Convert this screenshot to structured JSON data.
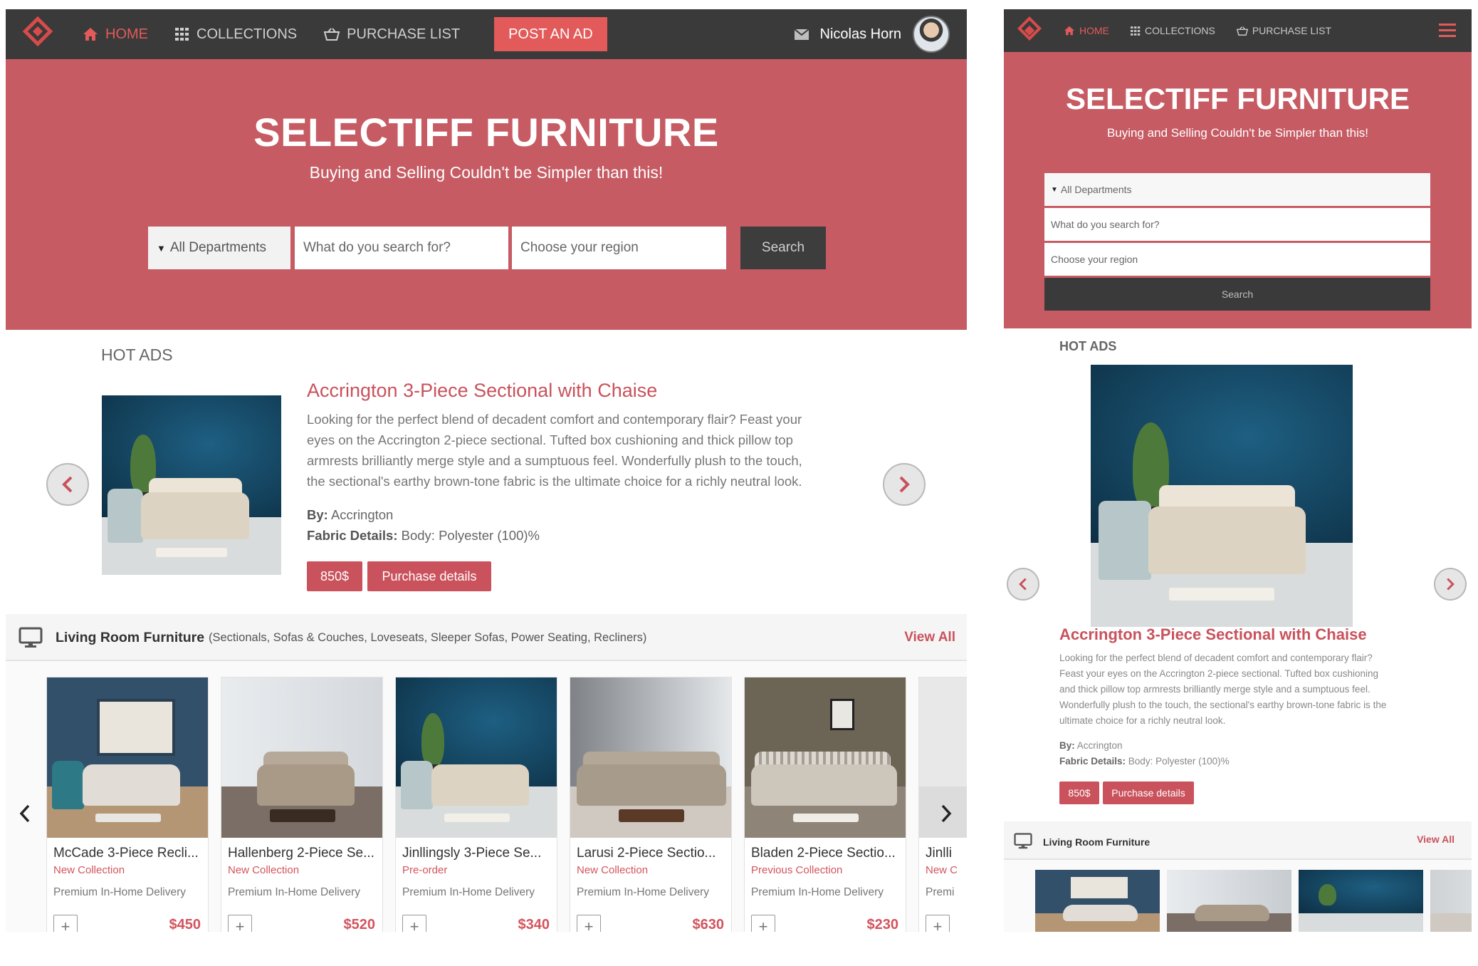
{
  "brand": {
    "accent": "#c65b63",
    "nav_bg": "#3a3a3a",
    "link_red": "#d94b4b"
  },
  "nav": {
    "items": [
      {
        "label": "HOME",
        "icon": "home-icon",
        "active": true
      },
      {
        "label": "COLLECTIONS",
        "icon": "grid-icon",
        "active": false
      },
      {
        "label": "PURCHASE LIST",
        "icon": "basket-icon",
        "active": false
      }
    ],
    "post_ad": "POST AN AD",
    "user_name": "Nicolas Horn"
  },
  "hero": {
    "title": "SELECTIFF FURNITURE",
    "subtitle": "Buying and Selling Couldn't be Simpler than this!",
    "department": "All Departments",
    "search_placeholder": "What do you search for?",
    "region_placeholder": "Choose your region",
    "search_button": "Search"
  },
  "hot_ads": {
    "heading": "HOT ADS",
    "title": "Accrington 3-Piece Sectional with Chaise",
    "desc_lines": [
      "Looking for the perfect blend of decadent comfort and contemporary flair? Feast your",
      "eyes on the Accrington 2-piece sectional. Tufted box cushioning and thick pillow top",
      "armrests brilliantly merge style and a sumptuous feel. Wonderfully plush to the touch,",
      "the sectional's earthy brown-tone fabric is the ultimate choice for a richly neutral look."
    ],
    "mobile_desc_lines": [
      "Looking for the perfect blend of decadent comfort and contemporary flair?",
      "Feast your eyes on the Accrington 2-piece sectional. Tufted box cushioning",
      "and thick pillow top armrests brilliantly merge style and a sumptuous feel.",
      "Wonderfully plush to the touch, the sectional's earthy brown-tone fabric is the",
      "ultimate choice for a richly neutral look."
    ],
    "by_label": "By:",
    "by_value": "Accrington",
    "fabric_label": "Fabric Details:",
    "fabric_value": "Body: Polyester (100)%",
    "price": "850$",
    "details_button": "Purchase details"
  },
  "section": {
    "title": "Living Room Furniture",
    "subcats": "(Sectionals, Sofas & Couches, Loveseats, Sleeper Sofas, Power Seating, Recliners)",
    "view_all": "View All",
    "mobile_view_all": "View All"
  },
  "products": [
    {
      "name": "McCade 3-Piece Recli...",
      "tag": "New Collection",
      "delivery": "Premium In-Home Delivery",
      "price": "$450"
    },
    {
      "name": "Hallenberg 2-Piece Se...",
      "tag": "New Collection",
      "delivery": "Premium In-Home Delivery",
      "price": "$520"
    },
    {
      "name": "Jinllingsly 3-Piece Se...",
      "tag": "Pre-order",
      "delivery": "Premium In-Home Delivery",
      "price": "$340"
    },
    {
      "name": "Larusi 2-Piece Sectio...",
      "tag": "New Collection",
      "delivery": "Premium In-Home Delivery",
      "price": "$630"
    },
    {
      "name": "Bladen 2-Piece Sectio...",
      "tag": "Previous Collection",
      "delivery": "Premium In-Home Delivery",
      "price": "$230"
    },
    {
      "name": "Jinlli",
      "tag": "New C",
      "delivery": "Premi",
      "price": ""
    }
  ]
}
